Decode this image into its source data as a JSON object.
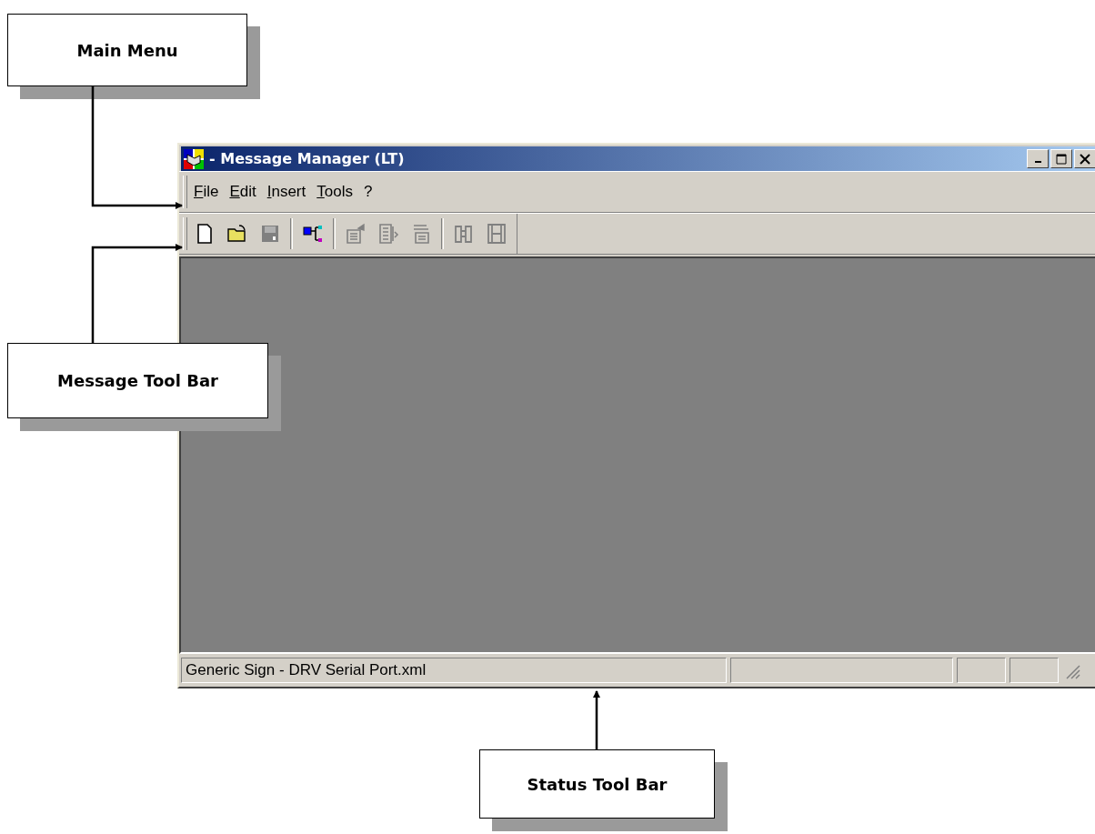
{
  "callouts": [
    {
      "label": "Main Menu",
      "kind": "menu"
    },
    {
      "label": "Message Tool Bar",
      "kind": "toolbar"
    },
    {
      "label": "Status Tool Bar",
      "kind": "status"
    }
  ],
  "window": {
    "title": "- Message Manager (LT)"
  },
  "menu": [
    "File",
    "Edit",
    "Insert",
    "Tools",
    "?"
  ],
  "toolbar": [
    [
      {
        "kind": "page",
        "disabled": false
      },
      {
        "kind": "folder",
        "disabled": false
      },
      {
        "kind": "disk",
        "disabled": true
      }
    ],
    [
      {
        "kind": "tree",
        "disabled": false
      }
    ],
    [
      {
        "kind": "properties",
        "disabled": true
      },
      {
        "kind": "edit",
        "disabled": true
      },
      {
        "kind": "stack",
        "disabled": true
      }
    ],
    [
      {
        "kind": "binoculars",
        "disabled": true
      },
      {
        "kind": "film",
        "disabled": true
      }
    ]
  ],
  "status_bar": [
    "Generic Sign - DRV Serial Port.xml"
  ]
}
